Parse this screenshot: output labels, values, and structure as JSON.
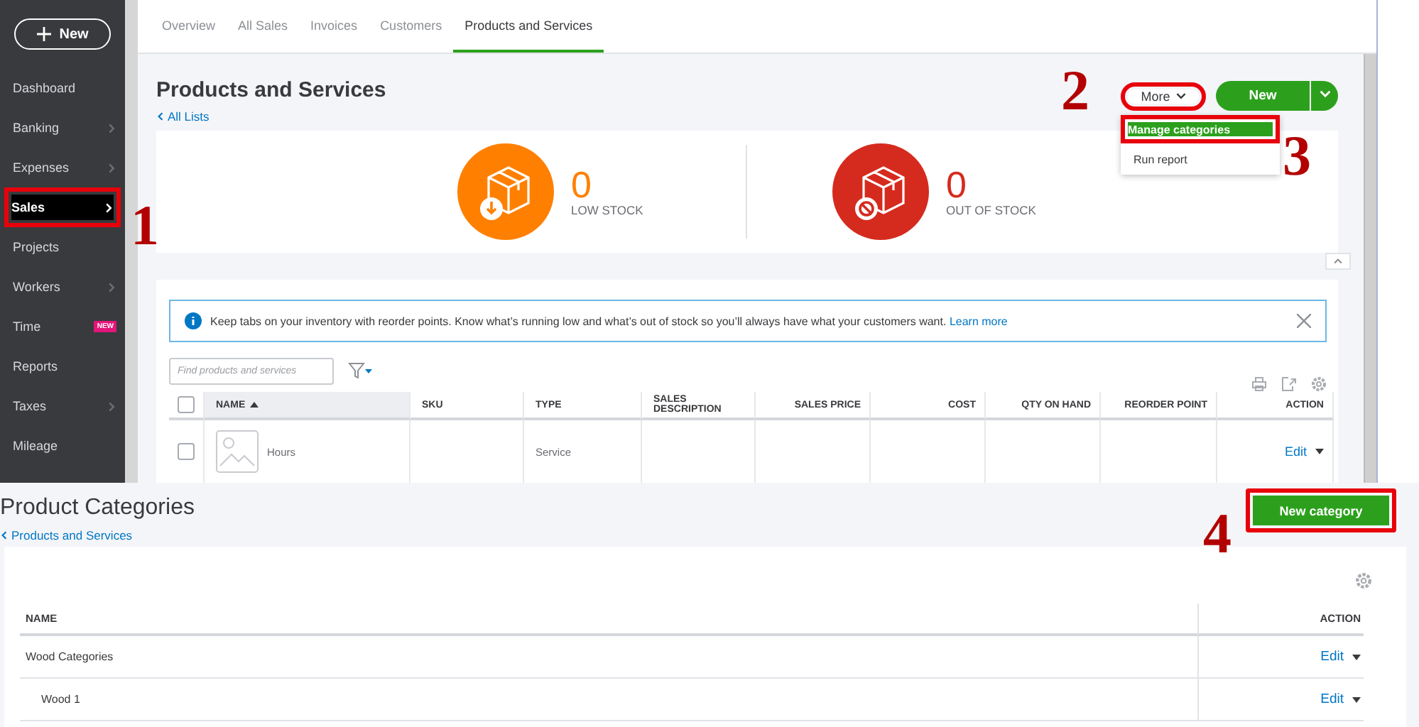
{
  "sidebar": {
    "new_button": "New",
    "items": [
      {
        "label": "Dashboard",
        "chevron": false,
        "selected": false,
        "marked": false
      },
      {
        "label": "Banking",
        "chevron": true,
        "selected": false,
        "marked": false
      },
      {
        "label": "Expenses",
        "chevron": true,
        "selected": false,
        "marked": false
      },
      {
        "label": "Sales",
        "chevron": true,
        "selected": true,
        "marked": true
      },
      {
        "label": "Projects",
        "chevron": false,
        "selected": false,
        "marked": false
      },
      {
        "label": "Workers",
        "chevron": true,
        "selected": false,
        "marked": false
      },
      {
        "label": "Time",
        "chevron": false,
        "selected": false,
        "marked": false,
        "badge": "NEW"
      },
      {
        "label": "Reports",
        "chevron": false,
        "selected": false,
        "marked": false
      },
      {
        "label": "Taxes",
        "chevron": true,
        "selected": false,
        "marked": false
      },
      {
        "label": "Mileage",
        "chevron": false,
        "selected": false,
        "marked": false
      }
    ]
  },
  "tabs": [
    {
      "label": "Overview",
      "selected": false
    },
    {
      "label": "All Sales",
      "selected": false
    },
    {
      "label": "Invoices",
      "selected": false
    },
    {
      "label": "Customers",
      "selected": false
    },
    {
      "label": "Products and Services",
      "selected": true
    }
  ],
  "page": {
    "title": "Products and Services",
    "back_link": "All Lists",
    "more_button": {
      "label": "More",
      "marked": true
    },
    "new_button": "New",
    "menu": [
      {
        "label": "Manage categories",
        "highlighted": true,
        "marked": true
      },
      {
        "label": "Run report",
        "highlighted": false,
        "marked": false
      }
    ]
  },
  "stock": [
    {
      "kind": "low",
      "count": "0",
      "label": "LOW STOCK"
    },
    {
      "kind": "out",
      "count": "0",
      "label": "OUT OF STOCK"
    }
  ],
  "notice": {
    "text": "Keep tabs on your inventory with reorder points. Know what’s running low and what’s out of stock so you’ll always have what your customers want.",
    "link": "Learn more"
  },
  "search": {
    "placeholder": "Find products and services"
  },
  "table": {
    "select_all": {
      "checked": false
    },
    "columns": [
      {
        "label": "NAME",
        "sorted": true
      },
      {
        "label": "SKU",
        "sorted": false
      },
      {
        "label": "TYPE",
        "sorted": false
      },
      {
        "label": "SALES DESCRIPTION",
        "sorted": false
      },
      {
        "label": "SALES PRICE",
        "sorted": false
      },
      {
        "label": "COST",
        "sorted": false
      },
      {
        "label": "QTY ON HAND",
        "sorted": false
      },
      {
        "label": "REORDER POINT",
        "sorted": false
      },
      {
        "label": "ACTION",
        "sorted": false
      }
    ],
    "rows": [
      {
        "checked": false,
        "name": "Hours",
        "type": "Service",
        "action": "Edit"
      }
    ]
  },
  "categories": {
    "title": "Product Categories",
    "back_link": "Products and Services",
    "new_button": {
      "label": "New category",
      "marked": true
    },
    "columns": [
      "NAME",
      "ACTION"
    ],
    "rows": [
      {
        "name": "Wood Categories",
        "action": "Edit",
        "children": [
          {
            "name": "Wood 1",
            "action": "Edit"
          }
        ]
      }
    ]
  },
  "annotations": [
    {
      "number": "1"
    },
    {
      "number": "2"
    },
    {
      "number": "3"
    },
    {
      "number": "4"
    }
  ]
}
